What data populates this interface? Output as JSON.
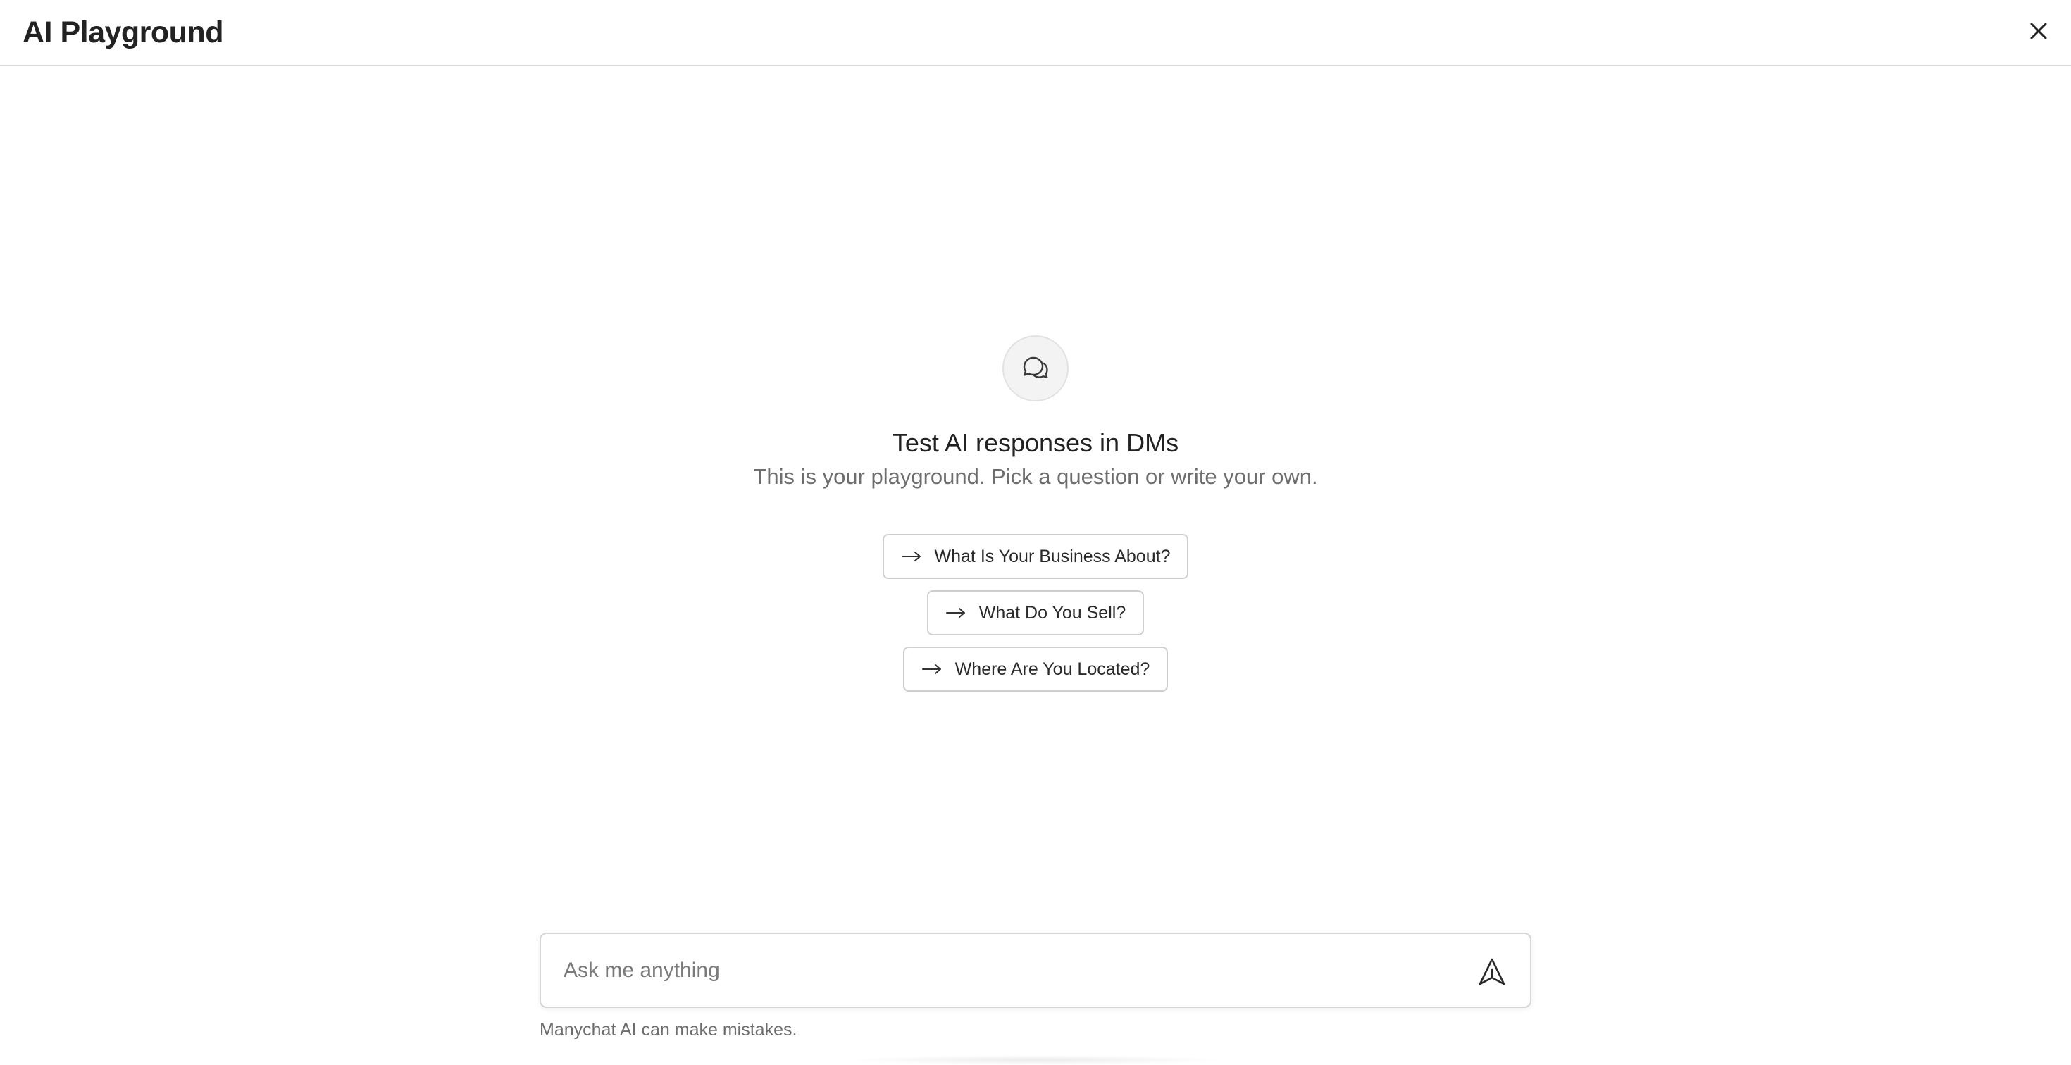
{
  "header": {
    "title": "AI Playground",
    "close_icon": "close-icon"
  },
  "empty_state": {
    "icon": "chat-bubbles-icon",
    "headline": "Test AI responses in DMs",
    "subline": "This is your playground. Pick a question or write your own.",
    "suggestions": [
      {
        "label": "What Is Your Business About?",
        "icon": "arrow-right-icon"
      },
      {
        "label": "What Do You Sell?",
        "icon": "arrow-right-icon"
      },
      {
        "label": "Where Are You Located?",
        "icon": "arrow-right-icon"
      }
    ]
  },
  "composer": {
    "placeholder": "Ask me anything",
    "value": "",
    "send_icon": "send-icon"
  },
  "disclaimer": "Manychat AI can make mistakes.",
  "colors": {
    "border": "#d9d9d9",
    "text_primary": "#222222",
    "text_secondary": "#6e6e6e",
    "icon_bg": "#f3f3f3"
  }
}
